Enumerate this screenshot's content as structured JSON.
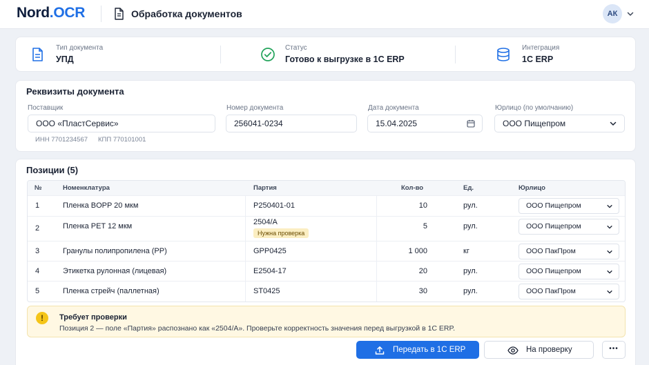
{
  "header": {
    "logo_main": "Nord",
    "logo_dot": ".",
    "logo_accent": "OCR",
    "title": "Обработка документов",
    "avatar_initials": "АК"
  },
  "summary": {
    "doc_type_label": "Тип документа",
    "doc_type_value": "УПД",
    "status_label": "Статус",
    "status_value": "Готово к выгрузке в 1С ERP",
    "integration_label": "Интеграция",
    "integration_value": "1С ERP"
  },
  "requisites": {
    "title": "Реквизиты документа",
    "supplier_label": "Поставщик",
    "supplier_value": "ООО «ПластСервис»",
    "inn": "ИНН 7701234567",
    "kpp": "КПП 770101001",
    "number_label": "Номер документа",
    "number_value": "256041-0234",
    "date_label": "Дата документа",
    "date_value": "15.04.2025",
    "entity_label": "Юрлицо (по умолчанию)",
    "entity_value": "ООО Пищепром"
  },
  "positions": {
    "title": "Позиции (5)",
    "columns": {
      "num": "№",
      "name": "Номенклатура",
      "batch": "Партия",
      "qty": "Кол-во",
      "unit": "Ед.",
      "entity": "Юрлицо"
    },
    "rows": [
      {
        "num": "1",
        "name": "Пленка BOPP 20 мкм",
        "batch": "P250401-01",
        "badge": "",
        "qty": "10",
        "unit": "рул.",
        "entity": "ООО Пищепром"
      },
      {
        "num": "2",
        "name": "Пленка PET 12 мкм",
        "batch": "2504/A",
        "badge": "Нужна проверка",
        "qty": "5",
        "unit": "рул.",
        "entity": "ООО Пищепром"
      },
      {
        "num": "3",
        "name": "Гранулы полипропилена (PP)",
        "batch": "GPP0425",
        "badge": "",
        "qty": "1 000",
        "unit": "кг",
        "entity": "ООО ПакПром"
      },
      {
        "num": "4",
        "name": "Этикетка рулонная (лицевая)",
        "batch": "E2504-17",
        "badge": "",
        "qty": "20",
        "unit": "рул.",
        "entity": "ООО Пищепром"
      },
      {
        "num": "5",
        "name": "Пленка стрейч (паллетная)",
        "batch": "ST0425",
        "badge": "",
        "qty": "30",
        "unit": "рул.",
        "entity": "ООО ПакПром"
      }
    ]
  },
  "warning": {
    "title": "Требует проверки",
    "text": "Позиция 2 — поле «Партия» распознано как «2504/A». Проверьте корректность значения перед выгрузкой в 1С ERP."
  },
  "actions": {
    "send_label": "Передать в 1С ERP",
    "review_label": "На проверку",
    "more_label": "•••"
  },
  "colors": {
    "accent": "#1f6fe5",
    "success": "#22a35a",
    "warning": "#f5c518",
    "badge_bg": "#fbeec2"
  }
}
